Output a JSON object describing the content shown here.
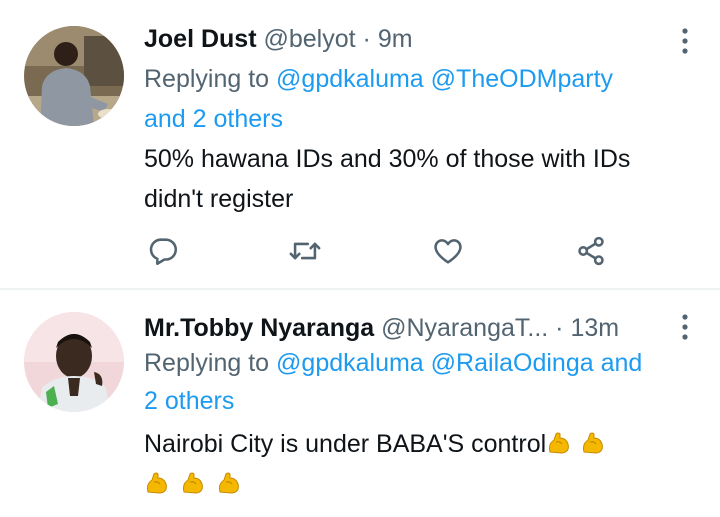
{
  "tweets": [
    {
      "display_name": "Joel Dust",
      "handle": "@belyot",
      "separator": "·",
      "time": "9m",
      "reply_prefix": "Replying to",
      "reply_mention_1": "@gpdkaluma",
      "reply_mention_2": "@TheODMparty",
      "reply_others": "and 2 others",
      "text_line_1": "50% hawana IDs and 30% of those with IDs",
      "text_line_2": "didn't register",
      "actions": [
        "reply-icon",
        "retweet-icon",
        "like-icon",
        "share-icon"
      ]
    },
    {
      "display_name": "Mr.Tobby Nyaranga",
      "handle": "@NyarangaT...",
      "separator": "·",
      "time": "13m",
      "reply_prefix": "Replying to",
      "reply_mention_1": "@gpdkaluma",
      "reply_mention_2": "@RailaOdinga",
      "reply_others_1": "and",
      "reply_others_2": "2 others",
      "text_line_1": "Nairobi City is under BABA'S control",
      "emoji": "flexed-biceps-icon"
    }
  ],
  "colors": {
    "text": "#0f1419",
    "secondary": "#536471",
    "link": "#1d9bf0",
    "divider": "#eff3f4"
  }
}
